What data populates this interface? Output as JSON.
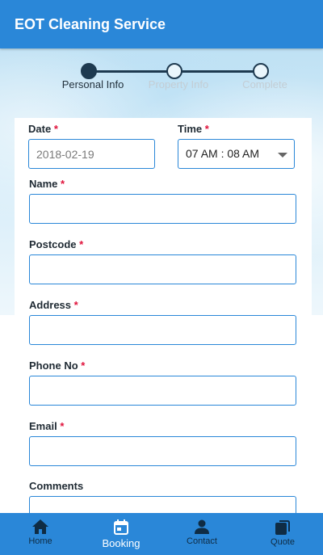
{
  "app": {
    "title": "EOT Cleaning Service"
  },
  "stepper": {
    "steps": [
      {
        "label": "Personal Info",
        "active": true
      },
      {
        "label": "Property Info",
        "active": false
      },
      {
        "label": "Complete",
        "active": false
      }
    ]
  },
  "form": {
    "date": {
      "label": "Date",
      "required": "*",
      "value": "2018-02-19"
    },
    "time": {
      "label": "Time",
      "required": "*",
      "value": "07 AM : 08 AM"
    },
    "name": {
      "label": "Name",
      "required": "*",
      "value": ""
    },
    "postcode": {
      "label": "Postcode",
      "required": "*",
      "value": ""
    },
    "address": {
      "label": "Address",
      "required": "*",
      "value": ""
    },
    "phone": {
      "label": "Phone No",
      "required": "*",
      "value": ""
    },
    "email": {
      "label": "Email",
      "required": "*",
      "value": ""
    },
    "comments": {
      "label": "Comments",
      "value": ""
    }
  },
  "bottom_nav": {
    "items": [
      {
        "label": "Home",
        "icon": "home-icon",
        "active": false
      },
      {
        "label": "Booking",
        "icon": "calendar-icon",
        "active": true
      },
      {
        "label": "Contact",
        "icon": "person-icon",
        "active": false
      },
      {
        "label": "Quote",
        "icon": "copy-icon",
        "active": false
      }
    ]
  },
  "colors": {
    "primary": "#2a87d8",
    "stepper_dark": "#1e3a50",
    "required": "#e0123b"
  }
}
